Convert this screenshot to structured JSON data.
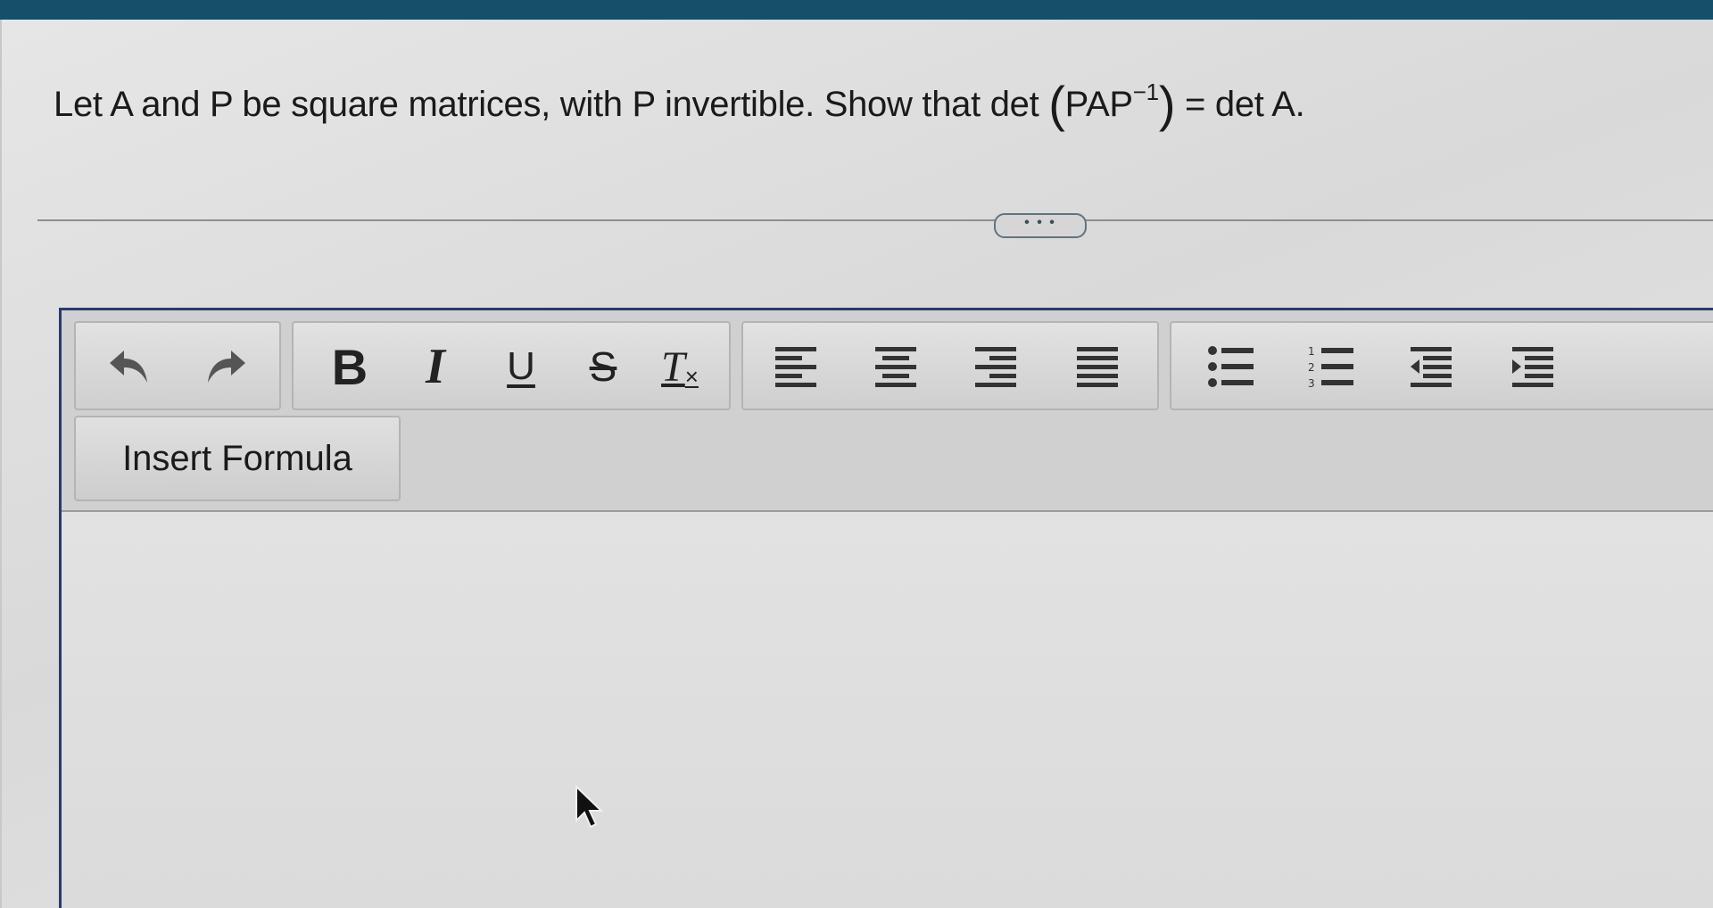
{
  "question": {
    "prefix": "Let A and P be square matrices, with P invertible. Show that det",
    "open_paren": "(",
    "inner": "PAP",
    "superscript": "−1",
    "close_paren": ")",
    "suffix": " = det A."
  },
  "divider": {
    "handle_label": "• • •"
  },
  "toolbar": {
    "undo_icon": "undo-icon",
    "redo_icon": "redo-icon",
    "bold_label": "B",
    "italic_label": "I",
    "underline_label": "U",
    "strike_label": "S",
    "clear_label": "T",
    "align_icons": [
      "align-left-icon",
      "align-center-icon",
      "align-right-icon",
      "align-justify-icon"
    ],
    "list_icons": [
      "bullet-list-icon",
      "numbered-list-icon",
      "outdent-icon",
      "indent-icon"
    ],
    "insert_formula_label": "Insert Formula"
  },
  "editor": {
    "content": ""
  }
}
